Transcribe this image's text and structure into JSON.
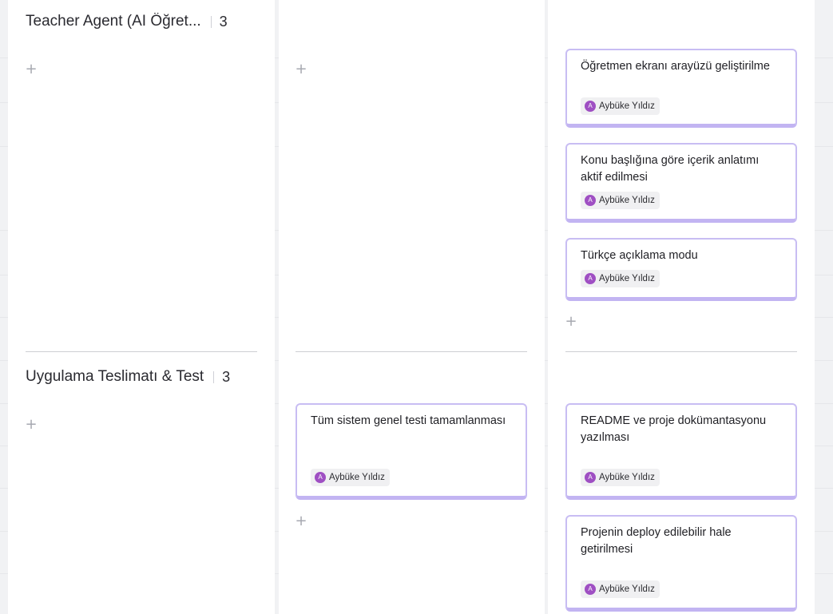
{
  "board": {
    "groups": [
      {
        "title": "Teacher Agent (AI Öğret...",
        "count": "3",
        "add_label": "+",
        "columns": [
          {
            "add_label": "+",
            "cards": []
          },
          {
            "add_label": "+",
            "cards": []
          },
          {
            "add_label": "+",
            "cards": [
              {
                "title": "Öğretmen ekranı arayüzü geliştirilme",
                "assignee": "Aybüke Yıldız",
                "avatar": "A"
              },
              {
                "title": "Konu başlığına göre içerik anlatımı aktif edilmesi",
                "assignee": "Aybüke Yıldız",
                "avatar": "A"
              },
              {
                "title": "Türkçe açıklama modu",
                "assignee": "Aybüke Yıldız",
                "avatar": "A"
              }
            ]
          }
        ]
      },
      {
        "title": "Uygulama Teslimatı & Test",
        "count": "3",
        "columns": [
          {
            "add_label": "+",
            "cards": []
          },
          {
            "add_label": "+",
            "cards": [
              {
                "title": "Tüm sistem genel testi tamamlanması",
                "assignee": "Aybüke Yıldız",
                "avatar": "A"
              }
            ]
          },
          {
            "cards": [
              {
                "title": "README ve proje dokümantasyonu yazılması",
                "assignee": "Aybüke Yıldız",
                "avatar": "A"
              },
              {
                "title": "Projenin deploy edilebilir hale getirilmesi",
                "assignee": "Aybüke Yıldız",
                "avatar": "A"
              }
            ]
          }
        ]
      }
    ]
  },
  "colors": {
    "card_border": "#c8bdf3",
    "avatar": "#9f4fc3",
    "background": "#f1f2f4"
  }
}
